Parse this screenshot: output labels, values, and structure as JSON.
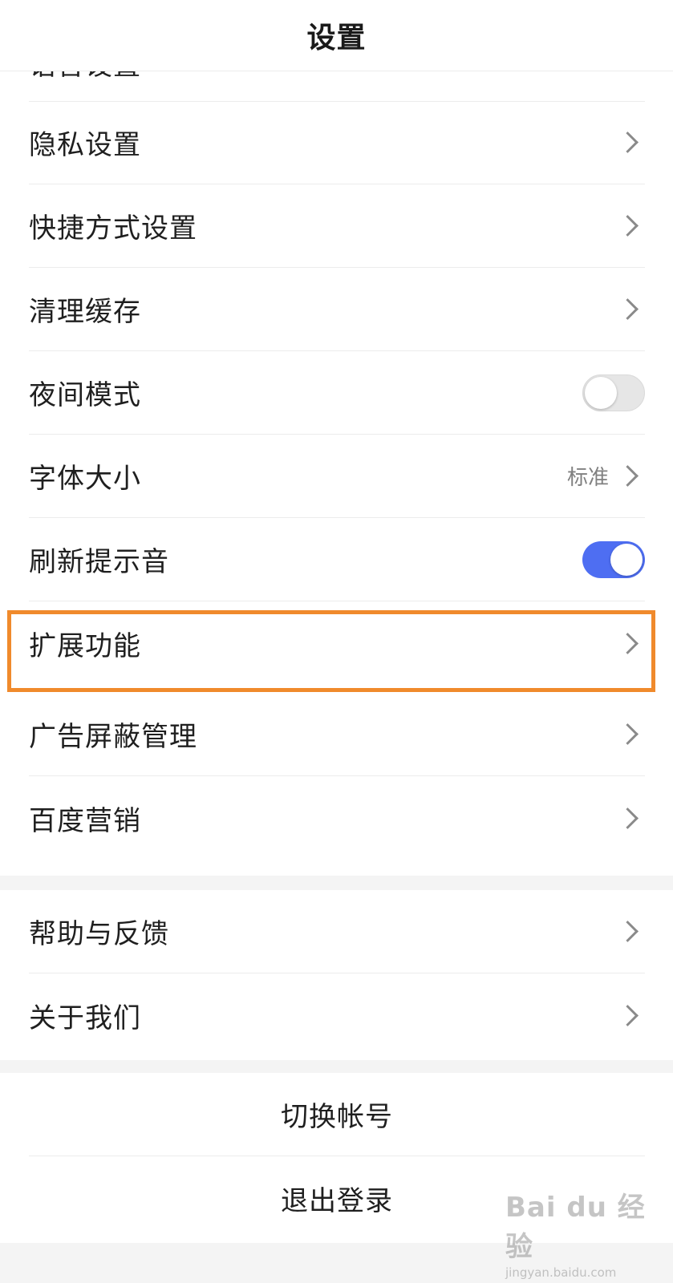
{
  "header": {
    "title": "设置"
  },
  "group_main": {
    "partial_item": {
      "label": "语音设置"
    },
    "items": [
      {
        "label": "隐私设置",
        "control": "chevron"
      },
      {
        "label": "快捷方式设置",
        "control": "chevron"
      },
      {
        "label": "清理缓存",
        "control": "chevron"
      },
      {
        "label": "夜间模式",
        "control": "toggle",
        "toggle_on": false
      },
      {
        "label": "字体大小",
        "control": "chevron",
        "value": "标准"
      },
      {
        "label": "刷新提示音",
        "control": "toggle",
        "toggle_on": true
      },
      {
        "label": "扩展功能",
        "control": "chevron",
        "highlighted": true
      },
      {
        "label": "广告屏蔽管理",
        "control": "chevron"
      },
      {
        "label": "百度营销",
        "control": "chevron"
      }
    ]
  },
  "group_help": {
    "items": [
      {
        "label": "帮助与反馈",
        "control": "chevron"
      },
      {
        "label": "关于我们",
        "control": "chevron"
      }
    ]
  },
  "account_actions": {
    "switch_account": "切换帐号",
    "logout": "退出登录"
  },
  "watermark": {
    "main": "Bai du 经验",
    "sub": "jingyan.baidu.com"
  },
  "colors": {
    "toggle_on": "#4e6ef2",
    "highlight": "#f08a2c",
    "background": "#f4f4f4"
  }
}
